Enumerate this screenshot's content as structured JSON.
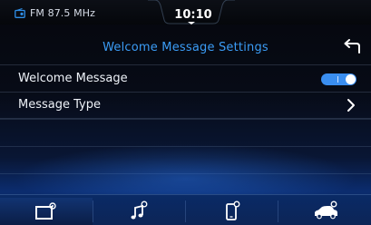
{
  "status_bar": {
    "radio_icon": "radio-icon",
    "radio_label": "FM 87.5 MHz",
    "time": "10:10"
  },
  "header": {
    "title": "Welcome Message Settings",
    "back_icon": "back-arrow-icon"
  },
  "settings": [
    {
      "label": "Welcome Message",
      "control": "toggle",
      "enabled": true
    },
    {
      "label": "Message Type",
      "control": "chevron"
    }
  ],
  "bottom_nav": [
    {
      "icon": "display-settings-icon",
      "active": true
    },
    {
      "icon": "sound-settings-icon",
      "active": false
    },
    {
      "icon": "phone-settings-icon",
      "active": false
    },
    {
      "icon": "vehicle-settings-icon",
      "active": false
    }
  ],
  "colors": {
    "accent": "#3b9cf5",
    "toggle_on": "#3a8ef0"
  }
}
